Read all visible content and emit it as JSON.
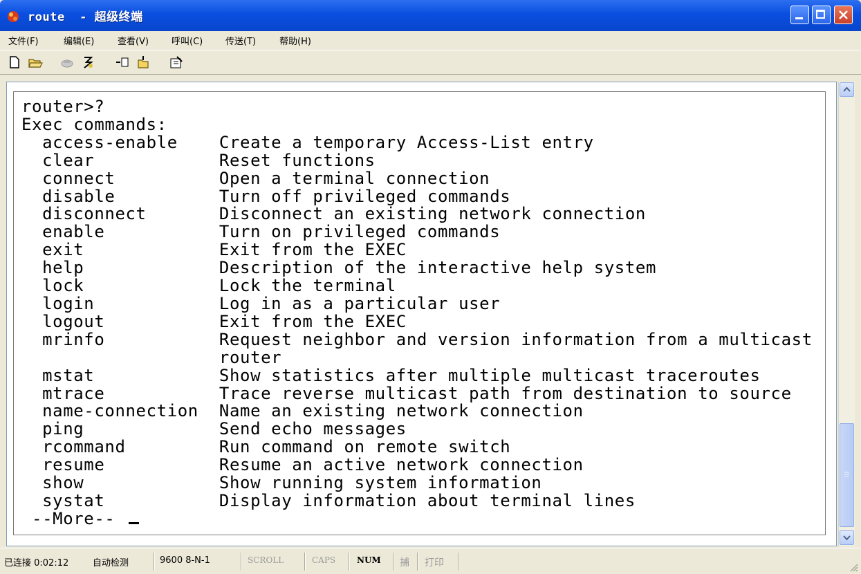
{
  "window": {
    "title": "route  - 超级终端",
    "colors": {
      "titlebar": "#0a4ee0",
      "terminal_bg": "#ffffff",
      "terminal_fg": "#000000"
    }
  },
  "menu": [
    "文件(F)",
    "编辑(E)",
    "查看(V)",
    "呼叫(C)",
    "传送(T)",
    "帮助(H)"
  ],
  "toolbar": [
    "new-icon",
    "open-icon",
    "call-icon",
    "disconnect-icon",
    "send-icon",
    "receive-icon",
    "properties-icon"
  ],
  "terminal": {
    "lines": [
      "router>?",
      "Exec commands:",
      "  access-enable    Create a temporary Access-List entry",
      "  clear            Reset functions",
      "  connect          Open a terminal connection",
      "  disable          Turn off privileged commands",
      "  disconnect       Disconnect an existing network connection",
      "  enable           Turn on privileged commands",
      "  exit             Exit from the EXEC",
      "  help             Description of the interactive help system",
      "  lock             Lock the terminal",
      "  login            Log in as a particular user",
      "  logout           Exit from the EXEC",
      "  mrinfo           Request neighbor and version information from a multicast",
      "                   router",
      "  mstat            Show statistics after multiple multicast traceroutes",
      "  mtrace           Trace reverse multicast path from destination to source",
      "  name-connection  Name an existing network connection",
      "  ping             Send echo messages",
      "  rcommand         Run command on remote switch",
      "  resume           Resume an active network connection",
      "  show             Show running system information",
      "  systat           Display information about terminal lines",
      " --More-- "
    ]
  },
  "status": {
    "connected": "已连接 0:02:12",
    "detect": "自动检测",
    "port": "9600 8-N-1",
    "scroll": "SCROLL",
    "caps": "CAPS",
    "num": "NUM",
    "capture": "捕",
    "print": "打印"
  }
}
